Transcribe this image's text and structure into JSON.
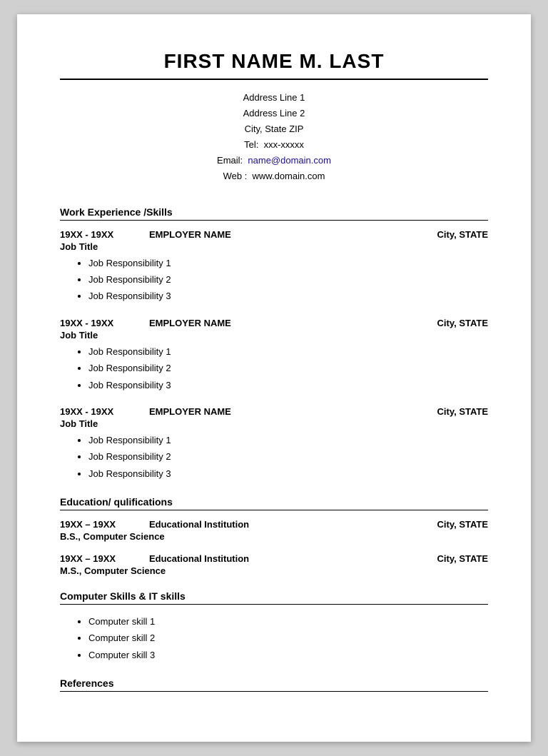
{
  "header": {
    "name": "FIRST NAME M. LAST",
    "address_line1": "Address Line 1",
    "address_line2": "Address Line 2",
    "city_state_zip": "City, State ZIP",
    "tel_label": "Tel:",
    "tel_value": "xxx-xxxxx",
    "email_label": "Email:",
    "email_link_text": "name@domain.com",
    "email_link_href": "mailto:name@domain.com",
    "web_label": "Web :",
    "web_value": "www.domain.com"
  },
  "sections": {
    "work_experience": {
      "label": "Work Experience /Skills",
      "jobs": [
        {
          "dates": "19XX - 19XX",
          "employer": "EMPLOYER NAME",
          "location": "City, STATE",
          "title": "Job Title",
          "responsibilities": [
            "Job Responsibility 1",
            "Job Responsibility 2",
            "Job Responsibility 3"
          ]
        },
        {
          "dates": "19XX - 19XX",
          "employer": "EMPLOYER NAME",
          "location": "City, STATE",
          "title": "Job Title",
          "responsibilities": [
            "Job Responsibility 1",
            "Job Responsibility 2",
            "Job Responsibility 3"
          ]
        },
        {
          "dates": "19XX - 19XX",
          "employer": "EMPLOYER NAME",
          "location": "City, STATE",
          "title": "Job Title",
          "responsibilities": [
            "Job Responsibility 1",
            "Job Responsibility 2",
            "Job Responsibility 3"
          ]
        }
      ]
    },
    "education": {
      "label": "Education/ qulifications",
      "entries": [
        {
          "dates": "19XX – 19XX",
          "institution": "Educational Institution",
          "location": "City, STATE",
          "degree": "B.S., Computer Science"
        },
        {
          "dates": "19XX – 19XX",
          "institution": "Educational Institution",
          "location": "City, STATE",
          "degree": "M.S., Computer Science"
        }
      ]
    },
    "computer_skills": {
      "label": "Computer Skills & IT skills",
      "skills": [
        "Computer skill 1",
        "Computer skill 2",
        "Computer skill 3"
      ]
    },
    "references": {
      "label": "References"
    }
  }
}
